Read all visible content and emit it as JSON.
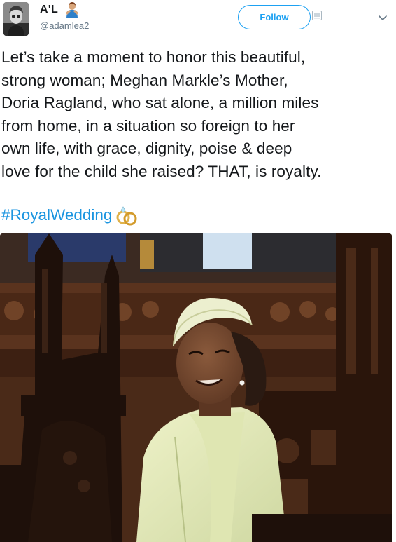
{
  "tweet": {
    "author_name": "A'L",
    "author_handle": "@adamlea2",
    "follow_label": "Follow",
    "text_lines": [
      "Let’s take a moment to honor this beautiful,",
      "strong woman; Meghan Markle’s Mother,",
      "Doria Ragland, who sat alone, a million miles",
      "from home, in a situation so foreign to her",
      "own life, with grace, dignity, poise & deep",
      "love for the child she raised? THAT, is royalty."
    ],
    "hashtag": "#RoyalWedding"
  },
  "icons": {
    "name_emoji": "man-gesturing-emoji-icon",
    "follow_extra": "follow-extra-icon",
    "menu": "chevron-down-icon",
    "hashtag_emoji": "wedding-rings-icon"
  },
  "colors": {
    "text": "#14171a",
    "secondary": "#657786",
    "accent": "#1da1f2",
    "link": "#1b95e0"
  }
}
